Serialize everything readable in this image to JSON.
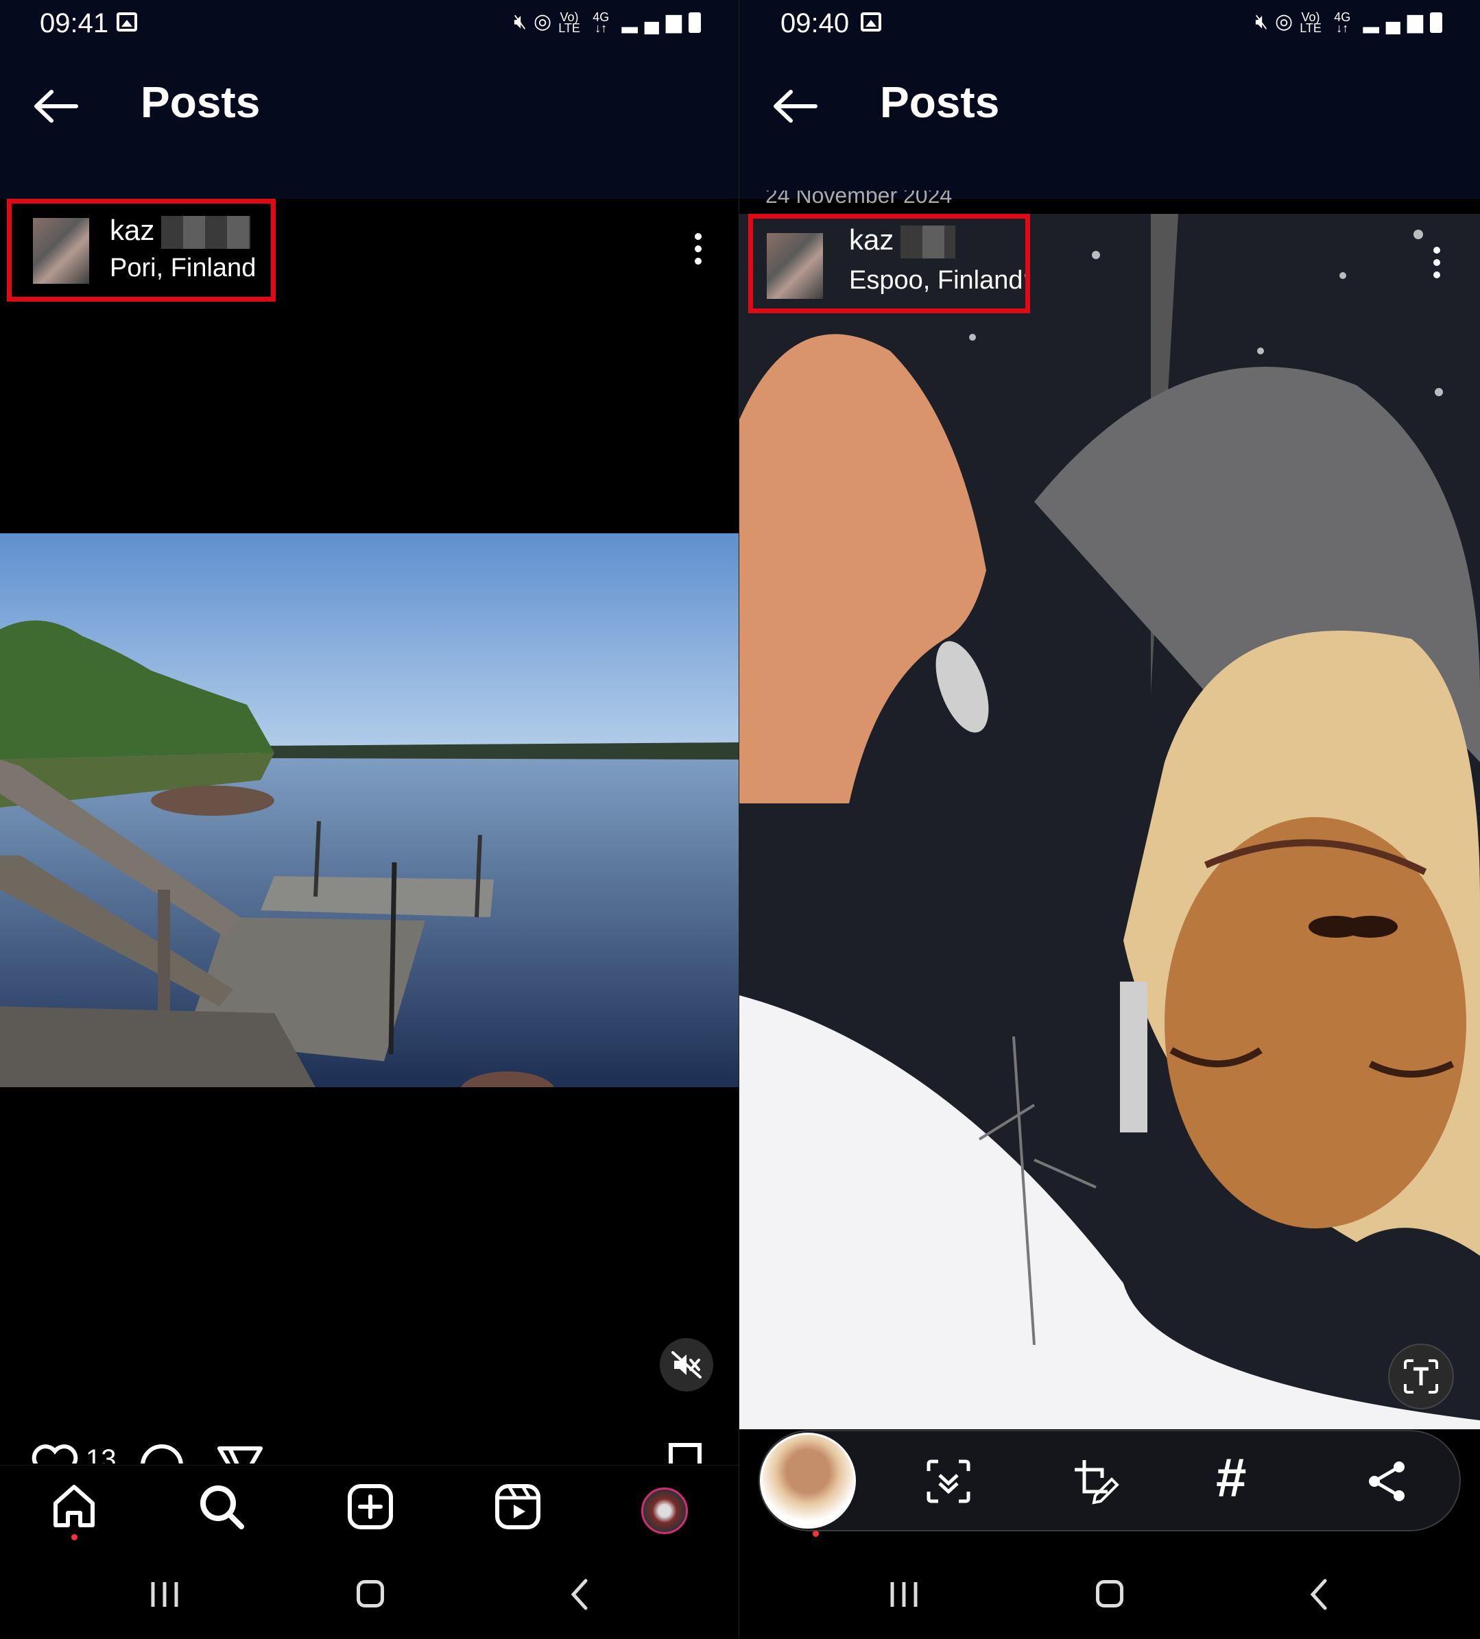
{
  "left": {
    "status": {
      "time": "09:41",
      "icons": [
        "photo-icon",
        "mute-icon",
        "hotspot-icon",
        "volte-icon",
        "4g-icon",
        "signal-icon",
        "battery-icon"
      ]
    },
    "appbar": {
      "title": "Posts"
    },
    "post": {
      "username": "kaz",
      "location": "Pori, Finland",
      "likes": "13"
    },
    "nav": {
      "items": [
        "home",
        "search",
        "create",
        "reels",
        "profile"
      ]
    }
  },
  "right": {
    "status": {
      "time": "09:40"
    },
    "appbar": {
      "title": "Posts"
    },
    "post": {
      "username": "kaz",
      "location": "Espoo, Finland",
      "date": "24 November 2024"
    },
    "toolbar": {
      "items": [
        "scan-icon",
        "crop-edit-icon",
        "hashtag-icon",
        "share-icon"
      ]
    }
  },
  "colors": {
    "highlight": "#e10a14",
    "background": "#000000",
    "appbar": "#050a1c",
    "notification_dot": "#ff3040"
  }
}
